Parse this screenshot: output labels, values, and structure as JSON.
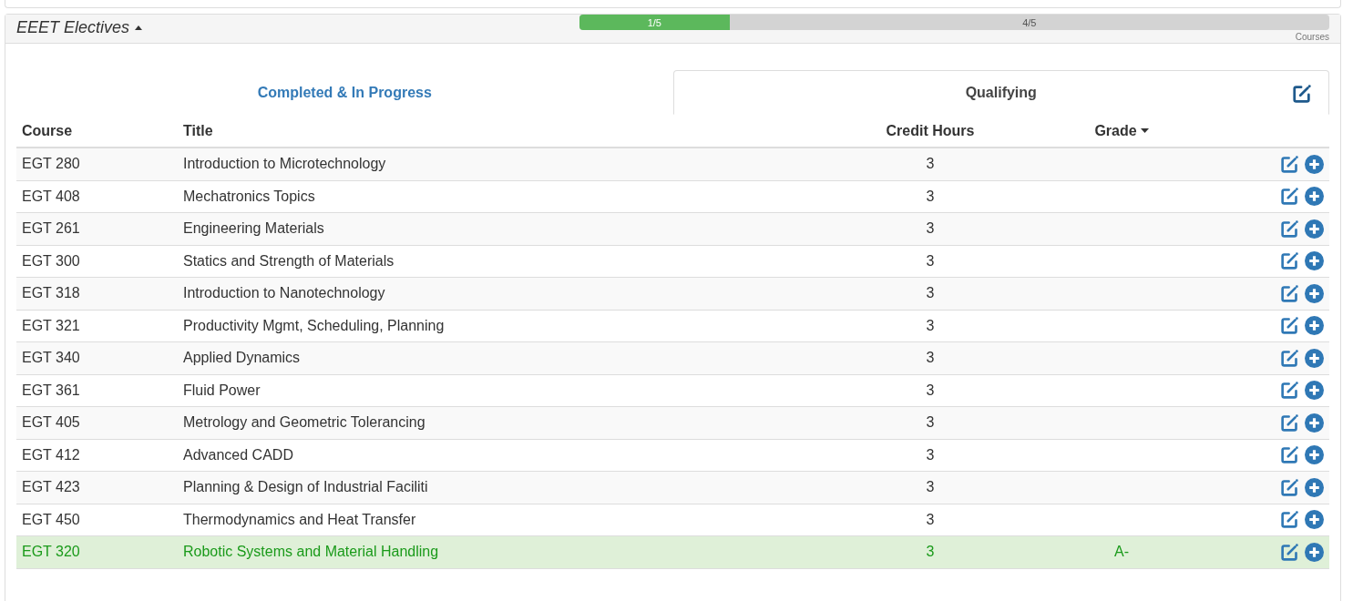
{
  "section": {
    "title": "EEET Electives",
    "expanded": true,
    "progress": {
      "level": 0.2,
      "done_label": "1/5",
      "remaining_label": "4/5",
      "unit": "Courses"
    }
  },
  "tabs": [
    {
      "label": "Completed & In Progress",
      "selected": false
    },
    {
      "label": "Qualifying",
      "selected": true
    }
  ],
  "table": {
    "columns": [
      "Course",
      "Title",
      "Credit Hours",
      "Grade"
    ],
    "rows": [
      {
        "course": "EGT 280",
        "title": "Introduction to Microtechnology",
        "credits": "3",
        "highlighted": false
      },
      {
        "course": "EGT 408",
        "title": "Mechatronics Topics",
        "credits": "3",
        "highlighted": false
      },
      {
        "course": "EGT 261",
        "title": "Engineering Materials",
        "credits": "3",
        "highlighted": false
      },
      {
        "course": "EGT 300",
        "title": "Statics and Strength of Materials",
        "credits": "3",
        "highlighted": false
      },
      {
        "course": "EGT 318",
        "title": "Introduction to Nanotechnology",
        "credits": "3",
        "highlighted": false
      },
      {
        "course": "EGT 321",
        "title": "Productivity Mgmt, Scheduling, Planning",
        "credits": "3",
        "highlighted": false
      },
      {
        "course": "EGT 340",
        "title": "Applied Dynamics",
        "credits": "3",
        "highlighted": false
      },
      {
        "course": "EGT 361",
        "title": "Fluid Power",
        "credits": "3",
        "highlighted": false
      },
      {
        "course": "EGT 405",
        "title": "Metrology and Geometric Tolerancing",
        "credits": "3",
        "highlighted": false
      },
      {
        "course": "EGT 412",
        "title": "Advanced CADD",
        "credits": "3",
        "highlighted": false
      },
      {
        "course": "EGT 423",
        "title": "Planning & Design of Industrial Faciliti",
        "credits": "3",
        "highlighted": false
      },
      {
        "course": "EGT 450",
        "title": "Thermodynamics and Heat Transfer",
        "credits": "3",
        "highlighted": false
      },
      {
        "course": "EGT 320",
        "title": "Robotic Systems and Material Handling",
        "credits": "3",
        "grade": "A-",
        "highlighted": true
      }
    ]
  }
}
